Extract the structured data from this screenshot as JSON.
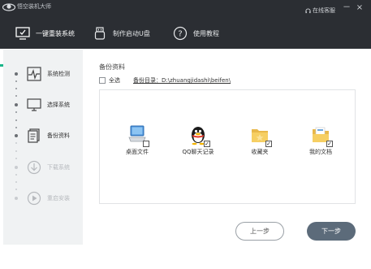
{
  "window": {
    "title": "悟空装机大师",
    "service_label": "在线客服",
    "minimize_glyph": "－",
    "close_glyph": "×"
  },
  "nav": {
    "tabs": [
      {
        "label": "一键重装系统",
        "icon": "monitor-icon",
        "active": true
      },
      {
        "label": "制作启动U盘",
        "icon": "usb-drive-icon",
        "active": false
      },
      {
        "label": "使用教程",
        "icon": "question-icon",
        "active": false
      }
    ],
    "accent": "#19b589"
  },
  "steps": [
    {
      "label": "系统检测",
      "icon": "pulse-icon",
      "state": "done"
    },
    {
      "label": "选择系统",
      "icon": "monitor-icon",
      "state": "done"
    },
    {
      "label": "备份资料",
      "icon": "document-icon",
      "state": "current"
    },
    {
      "label": "下载系统",
      "icon": "download-icon",
      "state": "pending"
    },
    {
      "label": "重启安装",
      "icon": "restart-icon",
      "state": "pending"
    }
  ],
  "backup": {
    "title": "备份资料",
    "select_all_label": "全选",
    "select_all_checked": false,
    "directory_label": "备份目录：D:\\zhuangjidashi\\beifen\\",
    "items": [
      {
        "label": "桌面文件",
        "icon": "desktop-icon",
        "checked": false
      },
      {
        "label": "QQ聊天记录",
        "icon": "qq-penguin-icon",
        "checked": true
      },
      {
        "label": "收藏夹",
        "icon": "favorites-folder-icon",
        "checked": true
      },
      {
        "label": "我的文档",
        "icon": "documents-folder-icon",
        "checked": true
      }
    ]
  },
  "buttons": {
    "prev_label": "上一步",
    "next_label": "下一步"
  }
}
